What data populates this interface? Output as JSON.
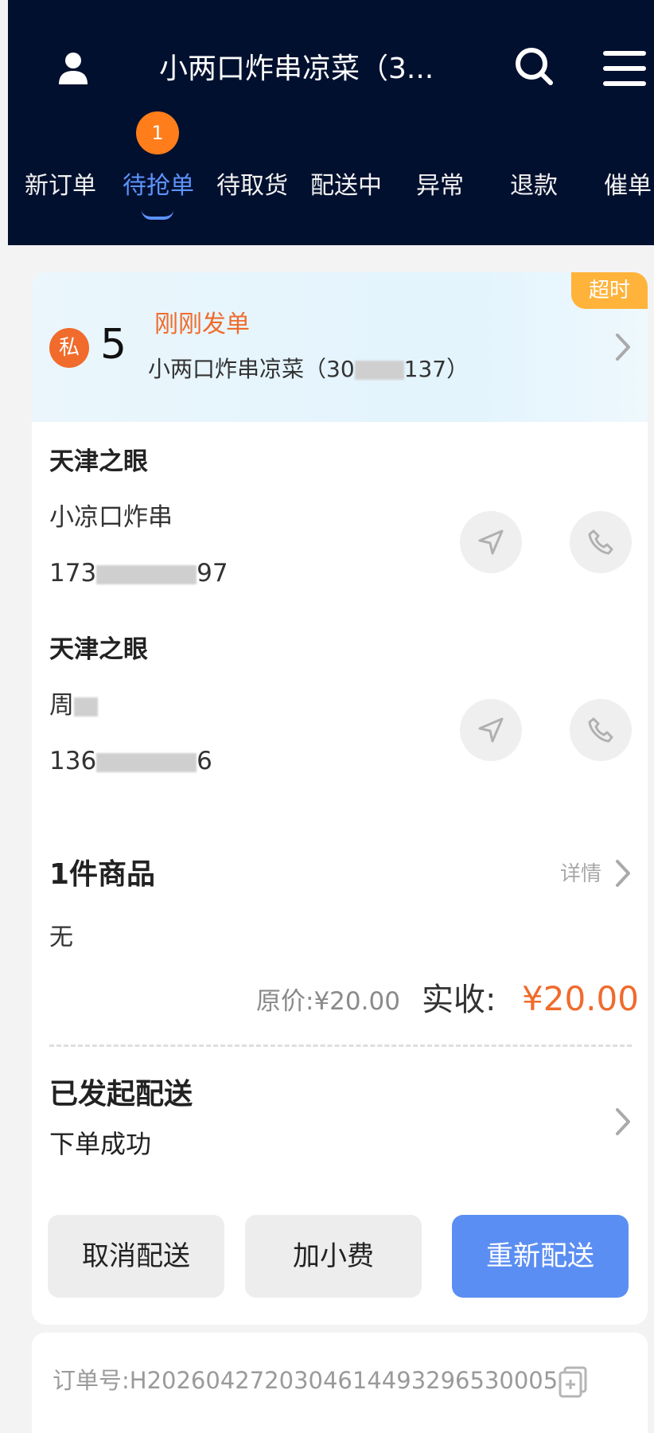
{
  "header": {
    "title": "小两口炸串凉菜（3...",
    "tabs": [
      {
        "label": "新订单"
      },
      {
        "label": "待抢单",
        "badge": "1",
        "active": true
      },
      {
        "label": "待取货"
      },
      {
        "label": "配送中"
      },
      {
        "label": "异常"
      },
      {
        "label": "退款"
      },
      {
        "label": "催单"
      }
    ],
    "icons": [
      "user-icon",
      "search-icon",
      "menu-icon"
    ]
  },
  "order": {
    "timeout_tag": "超时",
    "private_badge": "私",
    "number": "5",
    "status_text": "刚刚发单",
    "store_prefix": "小两口炸串凉菜（30",
    "store_suffix": "137）",
    "pickup": {
      "title": "天津之眼",
      "name": "小凉口炸串",
      "phone_prefix": "173",
      "phone_suffix": "97"
    },
    "dropoff": {
      "title": "天津之眼",
      "name_prefix": "周",
      "phone_prefix": "136",
      "phone_suffix": "6"
    },
    "goods": {
      "title": "1件商品",
      "detail_label": "详情",
      "remark": "无",
      "original_price": "原价:¥20.00",
      "actual_label": "实收:",
      "actual_price": "¥20.00"
    },
    "delivery": {
      "title": "已发起配送",
      "status": "下单成功"
    },
    "buttons": {
      "cancel": "取消配送",
      "tip": "加小费",
      "redeliver": "重新配送"
    },
    "order_id": "订单号:H2026042720304614493296530005"
  },
  "colors": {
    "header_bg": "#02102f",
    "active_tab": "#5d93ff",
    "badge": "#ff7d1a",
    "accent_orange": "#f06b2c",
    "timeout": "#ffb33a",
    "primary_button": "#5b8ef2"
  }
}
